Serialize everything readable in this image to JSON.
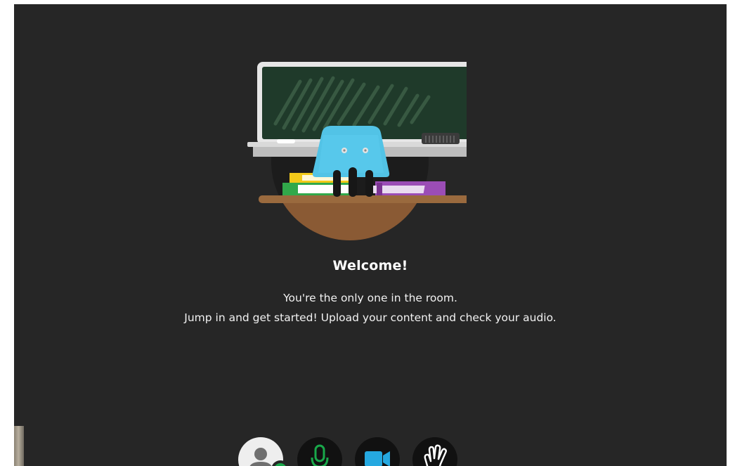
{
  "welcome": {
    "title": "Welcome!",
    "line1": "You're the only one in the room.",
    "line2": "Jump in and get started! Upload your content and check your audio."
  },
  "illustration": {
    "name": "classroom-illustration",
    "elements": [
      "chalkboard",
      "chair",
      "books",
      "desk"
    ]
  },
  "controls": [
    {
      "name": "user-avatar-button",
      "icon": "user-icon",
      "status": "online"
    },
    {
      "name": "microphone-button",
      "icon": "microphone-icon",
      "state": "on"
    },
    {
      "name": "camera-button",
      "icon": "video-camera-icon",
      "state": "on"
    },
    {
      "name": "raise-hand-button",
      "icon": "raise-hand-icon"
    }
  ],
  "colors": {
    "background": "#262626",
    "mic_accent": "#19a84a",
    "camera_accent": "#25a8e0",
    "status_online": "#19a84a"
  }
}
